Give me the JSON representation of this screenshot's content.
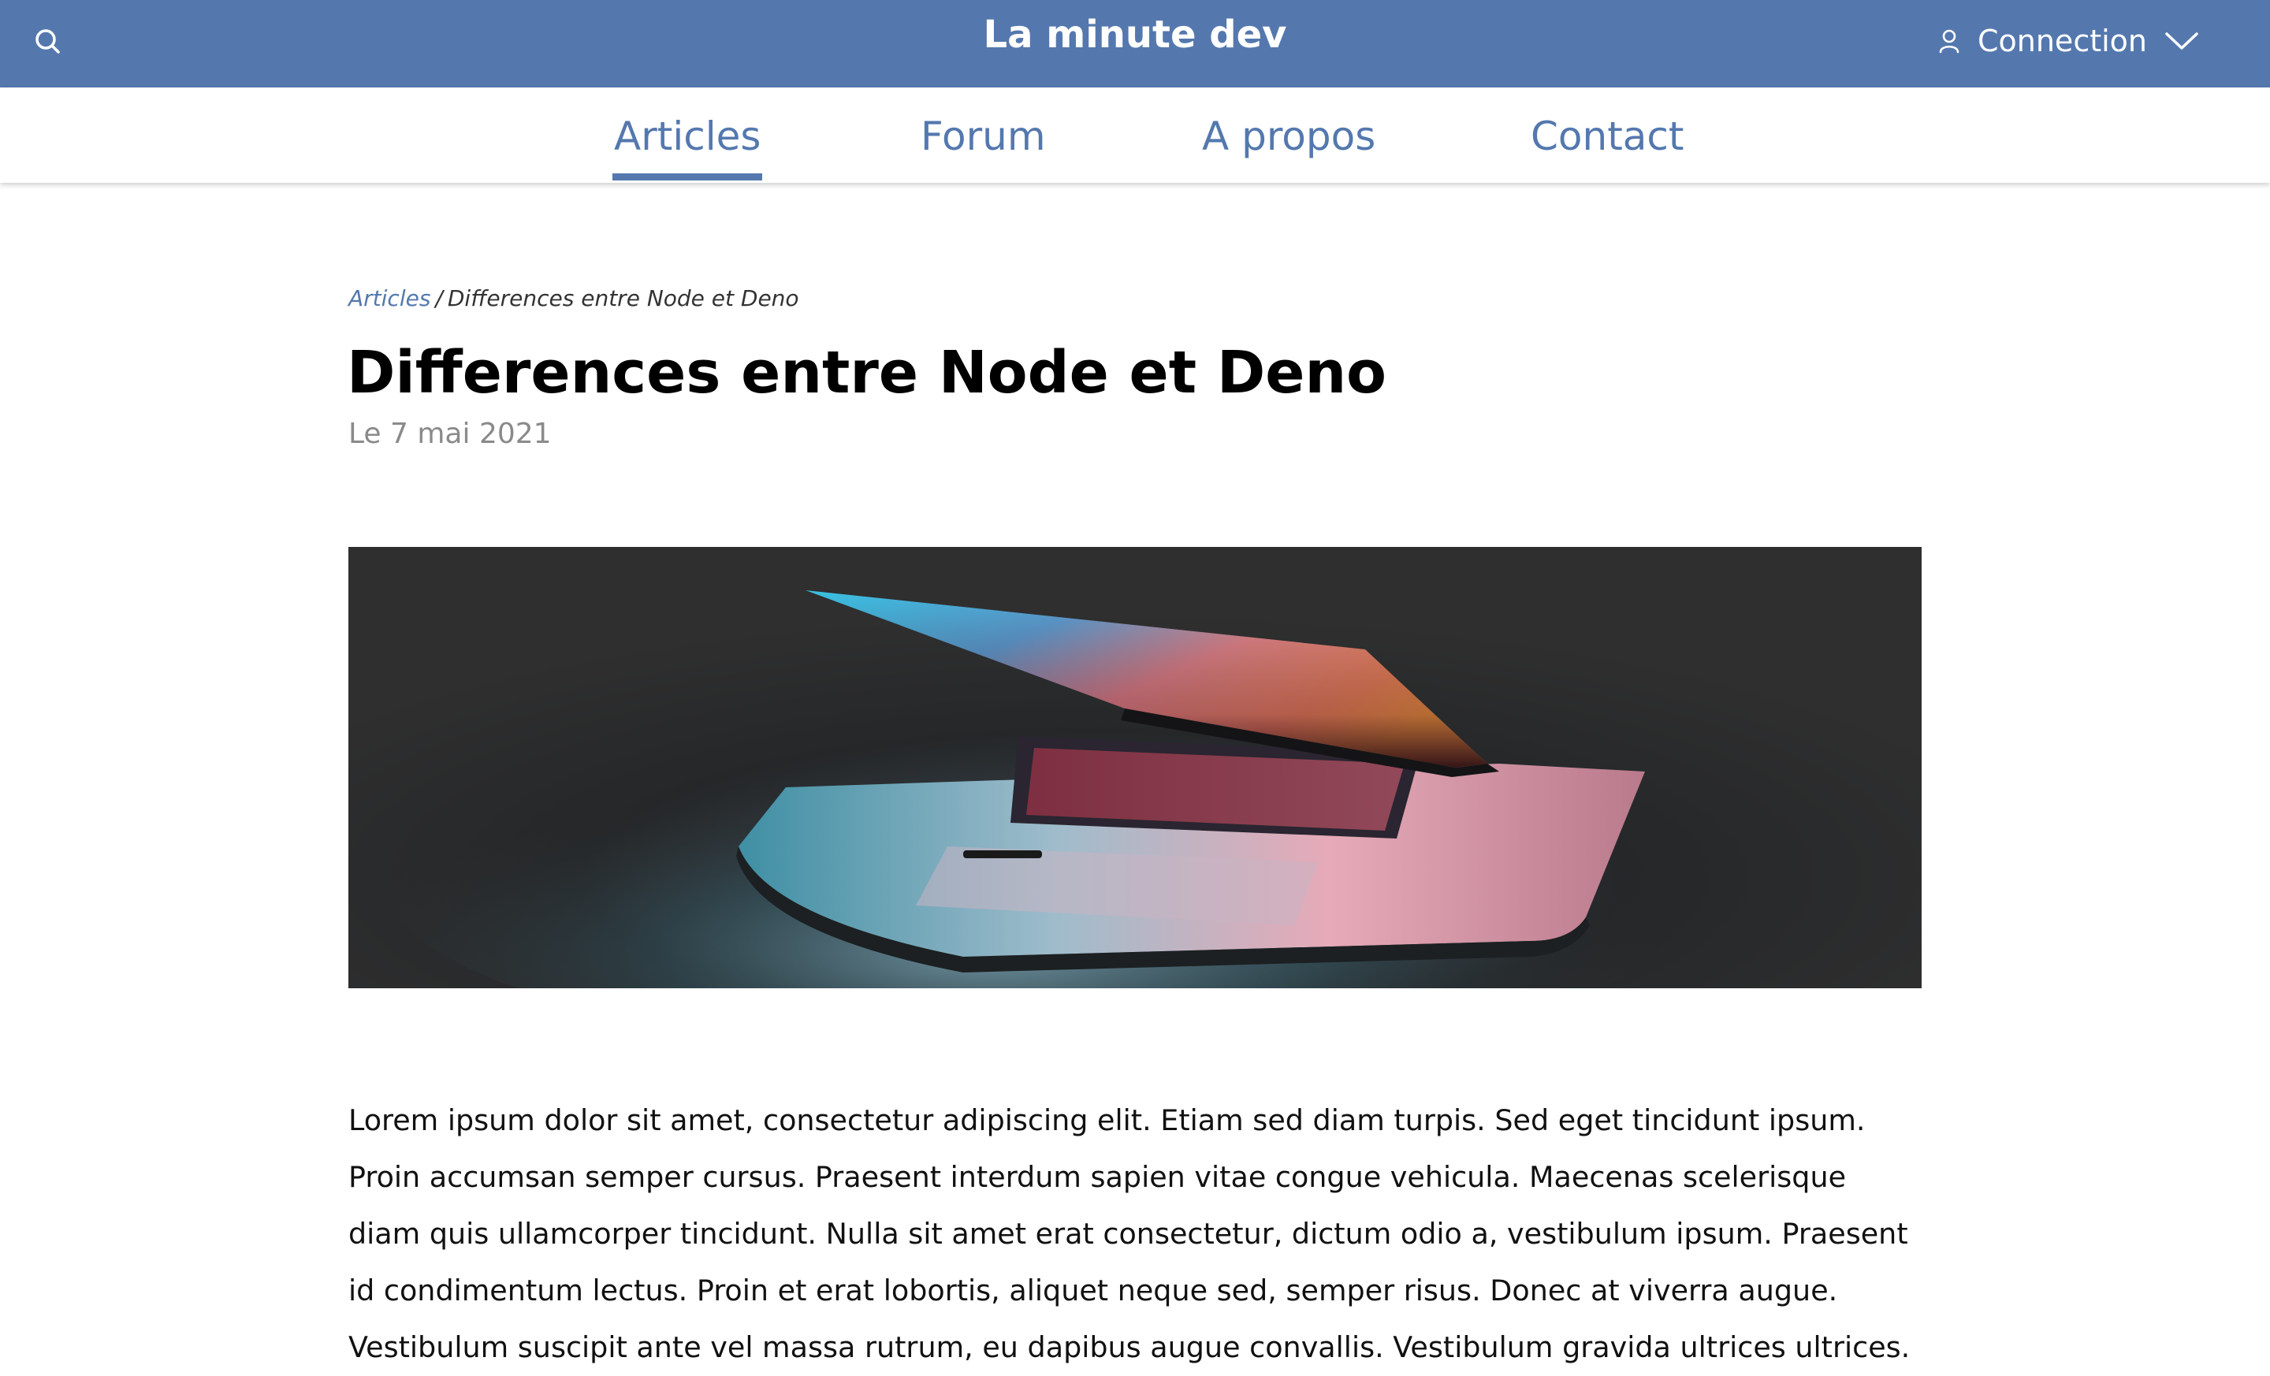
{
  "header": {
    "brand": "La minute dev",
    "search_icon": "search-icon",
    "connection_label": "Connection",
    "user_icon": "user-icon",
    "dropdown_icon": "chevron-down-icon"
  },
  "nav": {
    "items": [
      {
        "label": "Articles",
        "active": true
      },
      {
        "label": "Forum",
        "active": false
      },
      {
        "label": "A propos",
        "active": false
      },
      {
        "label": "Contact",
        "active": false
      }
    ]
  },
  "breadcrumb": {
    "root": "Articles",
    "separator": "/",
    "current": "Differences entre Node et Deno"
  },
  "article": {
    "title": "Differences entre Node et Deno",
    "date": "Le 7 mai 2021",
    "hero_image": "laptop-photo",
    "body": "Lorem ipsum dolor sit amet, consectetur adipiscing elit. Etiam sed diam turpis. Sed eget tincidunt ipsum. Proin accumsan semper cursus. Praesent interdum sapien vitae congue vehicula. Maecenas scelerisque diam quis ullamcorper tincidunt. Nulla sit amet erat consectetur, dictum odio a, vestibulum ipsum. Praesent id condimentum lectus. Proin et erat lobortis, aliquet neque sed, semper risus. Donec at viverra augue. Vestibulum suscipit ante vel massa rutrum, eu dapibus augue convallis. Vestibulum gravida ultrices ultrices."
  },
  "colors": {
    "brand_blue": "#5478ae",
    "date_gray": "#8a8a8a"
  }
}
